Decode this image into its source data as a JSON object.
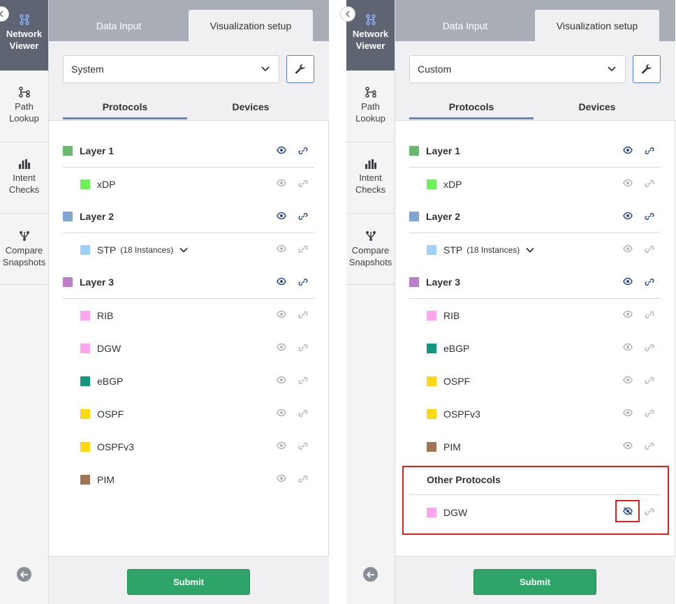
{
  "colors": {
    "layer1": "#6bb86d",
    "layer2": "#7fa6d3",
    "layer3": "#bb7fc9",
    "xdp": "#6ef25a",
    "stp": "#9fd1f8",
    "rib": "#ffa4ee",
    "dgw": "#ffa4ee",
    "ebgp": "#13957f",
    "ospf": "#fcd914",
    "ospfv3": "#fcd914",
    "pim": "#a07550",
    "accent": "#2ea468"
  },
  "left": {
    "sidebar": {
      "network_viewer": "Network\nViewer",
      "path_lookup": "Path\nLookup",
      "intent_checks": "Intent\nChecks",
      "compare_snapshots": "Compare\nSnapshots"
    },
    "tabs": {
      "data_input": "Data Input",
      "visualization_setup": "Visualization setup"
    },
    "select_value": "System",
    "subtabs": {
      "protocols": "Protocols",
      "devices": "Devices"
    },
    "layer1": "Layer 1",
    "xdp": "xDP",
    "layer2": "Layer 2",
    "stp": "STP",
    "stp_instances": "(18 Instances)",
    "layer3": "Layer 3",
    "p1": "RIB",
    "p2": "DGW",
    "p3": "eBGP",
    "p4": "OSPF",
    "p5": "OSPFv3",
    "p6": "PIM",
    "submit": "Submit"
  },
  "right": {
    "sidebar": {
      "network_viewer": "Network\nViewer",
      "path_lookup": "Path\nLookup",
      "intent_checks": "Intent\nChecks",
      "compare_snapshots": "Compare\nSnapshots"
    },
    "tabs": {
      "data_input": "Data Input",
      "visualization_setup": "Visualization setup"
    },
    "select_value": "Custom",
    "subtabs": {
      "protocols": "Protocols",
      "devices": "Devices"
    },
    "layer1": "Layer 1",
    "xdp": "xDP",
    "layer2": "Layer 2",
    "stp": "STP",
    "stp_instances": "(18 Instances)",
    "layer3": "Layer 3",
    "p1": "RIB",
    "p2": "eBGP",
    "p3": "OSPF",
    "p4": "OSPFv3",
    "p5": "PIM",
    "other_protocols": "Other Protocols",
    "other_dgw": "DGW",
    "submit": "Submit"
  }
}
